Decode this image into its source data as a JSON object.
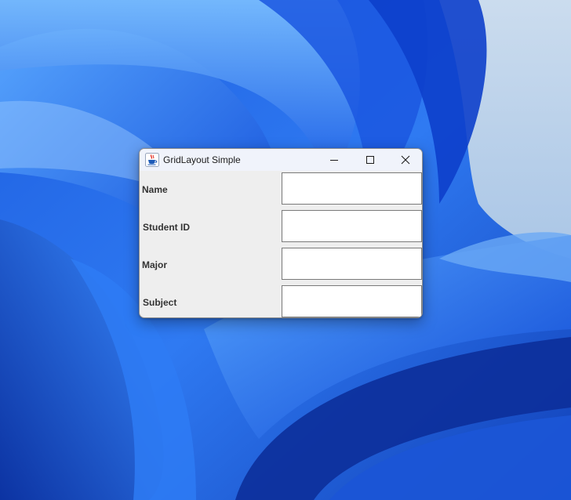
{
  "desktop": {
    "wallpaper": "windows-11-bloom-blue"
  },
  "window": {
    "title": "GridLayout Simple",
    "app_icon": "java-cup-icon",
    "controls": {
      "minimize_icon": "minimize-icon",
      "maximize_icon": "maximize-icon",
      "close_icon": "close-icon"
    }
  },
  "form": {
    "rows": [
      {
        "label": "Name",
        "value": ""
      },
      {
        "label": "Student ID",
        "value": ""
      },
      {
        "label": "Major",
        "value": ""
      },
      {
        "label": "Subject",
        "value": ""
      }
    ]
  },
  "colors": {
    "window_background": "#eeeeee",
    "titlebar_background": "#f0f3fb",
    "field_background": "#ffffff",
    "label_text": "#333333"
  }
}
